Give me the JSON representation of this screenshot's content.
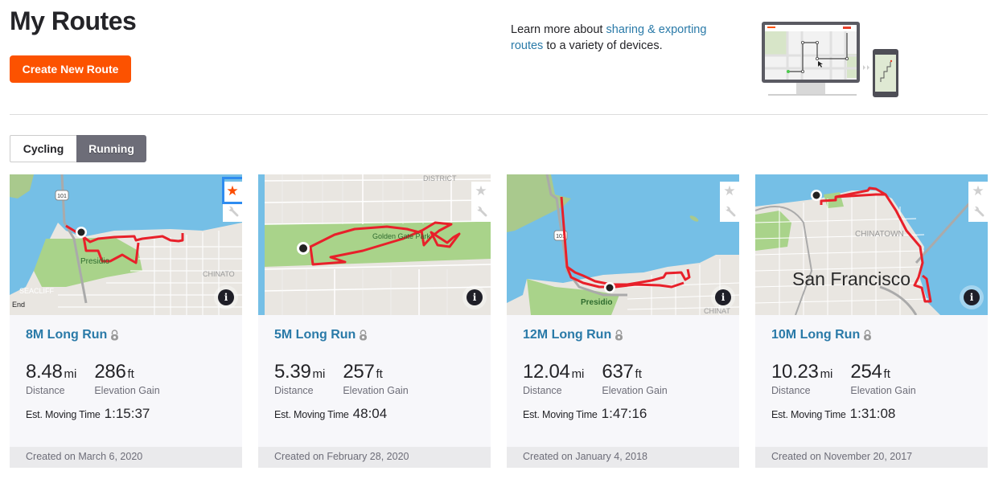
{
  "header": {
    "title": "My Routes",
    "create_button": "Create New Route"
  },
  "promo": {
    "prefix": "Learn more about ",
    "link": "sharing & exporting routes",
    "suffix": " to a variety of devices."
  },
  "tabs": [
    {
      "label": "Cycling",
      "active": false
    },
    {
      "label": "Running",
      "active": true
    }
  ],
  "labels": {
    "distance": "Distance",
    "elevation": "Elevation Gain",
    "moving_time": "Est. Moving Time",
    "distance_unit": "mi",
    "elevation_unit": "ft",
    "created_prefix": "Created on "
  },
  "colors": {
    "brand": "#fc5200",
    "link": "#2a7aa8",
    "route_line": "#e8202a",
    "water": "#75bfe6",
    "park": "#a9d38a"
  },
  "routes": [
    {
      "name": "8M Long Run",
      "private": true,
      "starred": true,
      "distance": "8.48",
      "elevation": "286",
      "moving_time": "1:15:37",
      "created": "Created on March 6, 2020",
      "map_labels": [
        "101",
        "Presidio",
        "SEACLIFF",
        "CHINATO",
        "End"
      ]
    },
    {
      "name": "5M Long Run",
      "private": true,
      "starred": false,
      "distance": "5.39",
      "elevation": "257",
      "moving_time": "48:04",
      "created": "Created on February 28, 2020",
      "map_labels": [
        "DISTRICT",
        "Golden Gate Park"
      ]
    },
    {
      "name": "12M Long Run",
      "private": true,
      "starred": false,
      "distance": "12.04",
      "elevation": "637",
      "moving_time": "1:47:16",
      "created": "Created on January 4, 2018",
      "map_labels": [
        "101",
        "Presidio",
        "CHINAT"
      ]
    },
    {
      "name": "10M Long Run",
      "private": true,
      "starred": false,
      "distance": "10.23",
      "elevation": "254",
      "moving_time": "1:31:08",
      "created": "Created on November 20, 2017",
      "map_labels": [
        "CHINATOWN",
        "San Francisco"
      ]
    }
  ],
  "icons": {
    "star": "★",
    "info": "i"
  }
}
